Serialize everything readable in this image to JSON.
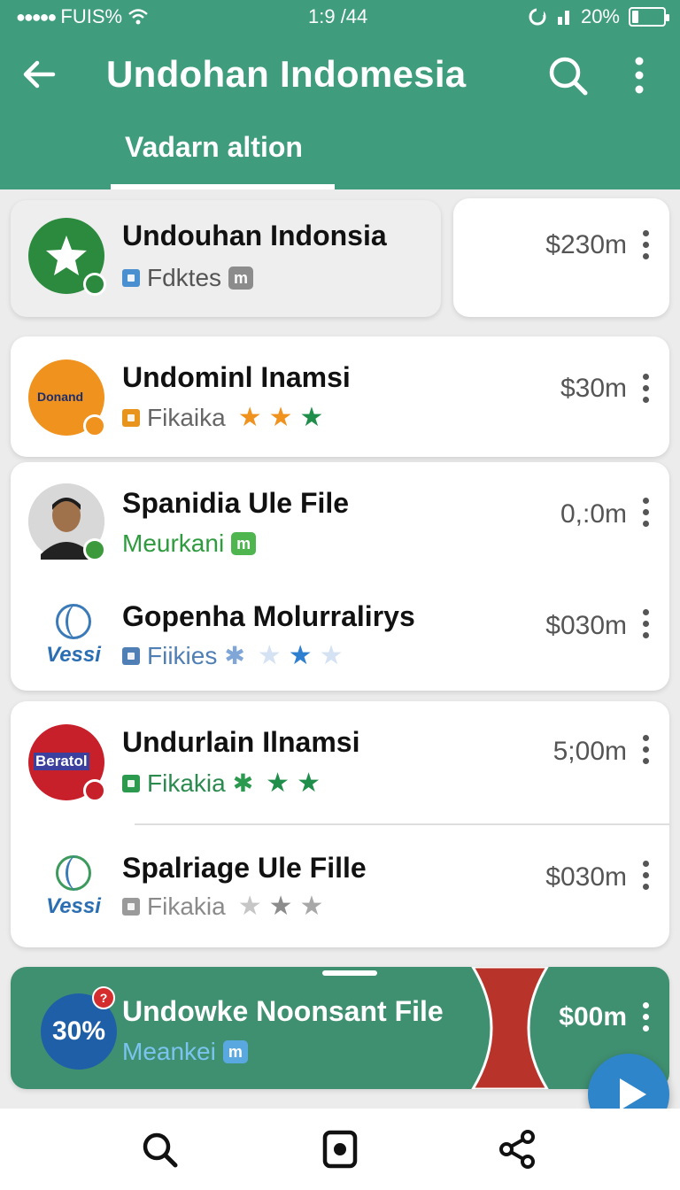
{
  "status_bar": {
    "carrier": "FUIS%",
    "time": "1:9 /44",
    "battery": "20%",
    "battery_level": 0.2
  },
  "app_bar": {
    "title": "Undohan Indomesia",
    "back_icon": "arrow-left-icon",
    "search_icon": "search-icon",
    "menu_icon": "more-vert-icon"
  },
  "tabs": [
    {
      "label": "Vadarn altion",
      "active": true
    }
  ],
  "items": [
    {
      "title": "Undouhan Indonsia",
      "subtitle": "Fdktes",
      "tag": "m",
      "price": "$230m",
      "avatar": "star-logo"
    },
    {
      "title": "Undominl Inamsi",
      "subtitle": "Fikaika",
      "price": "$30m",
      "logo_text": "Donand",
      "avatar": "orange-logo"
    },
    {
      "title": "Spanidia Ule File",
      "subtitle": "Meurkani",
      "tag": "m",
      "price": "0,:0m",
      "avatar": "person-photo"
    },
    {
      "title": "Gopenha Molurralirys",
      "subtitle": "Fiikies",
      "price": "$030m",
      "logo_text": "Vessi",
      "avatar": "vessi-logo"
    },
    {
      "title": "Undurlain Ilnamsi",
      "subtitle": "Fikakia",
      "price": "5;00m",
      "logo_text": "Beratol",
      "avatar": "red-logo"
    },
    {
      "title": "Spalriage Ule Fille",
      "subtitle": "Fikakia",
      "price": "$030m",
      "logo_text": "Vessi",
      "avatar": "vessi-logo"
    }
  ],
  "now_playing": {
    "progress": "30%",
    "badge": "?",
    "title": "Undowke Noonsant File",
    "subtitle": "Meankei",
    "tag": "m",
    "price": "$00m"
  },
  "fab": {
    "icon": "play-icon"
  },
  "bottom_nav": [
    {
      "icon": "search-icon"
    },
    {
      "icon": "record-icon"
    },
    {
      "icon": "share-icon"
    }
  ],
  "colors": {
    "primary": "#3f9c7c",
    "card_green": "#3f9070",
    "accent_blue": "#2f85c9",
    "star_orange": "#f0921e",
    "star_green": "#1f8e4a",
    "star_blue": "#2f7fd0"
  }
}
